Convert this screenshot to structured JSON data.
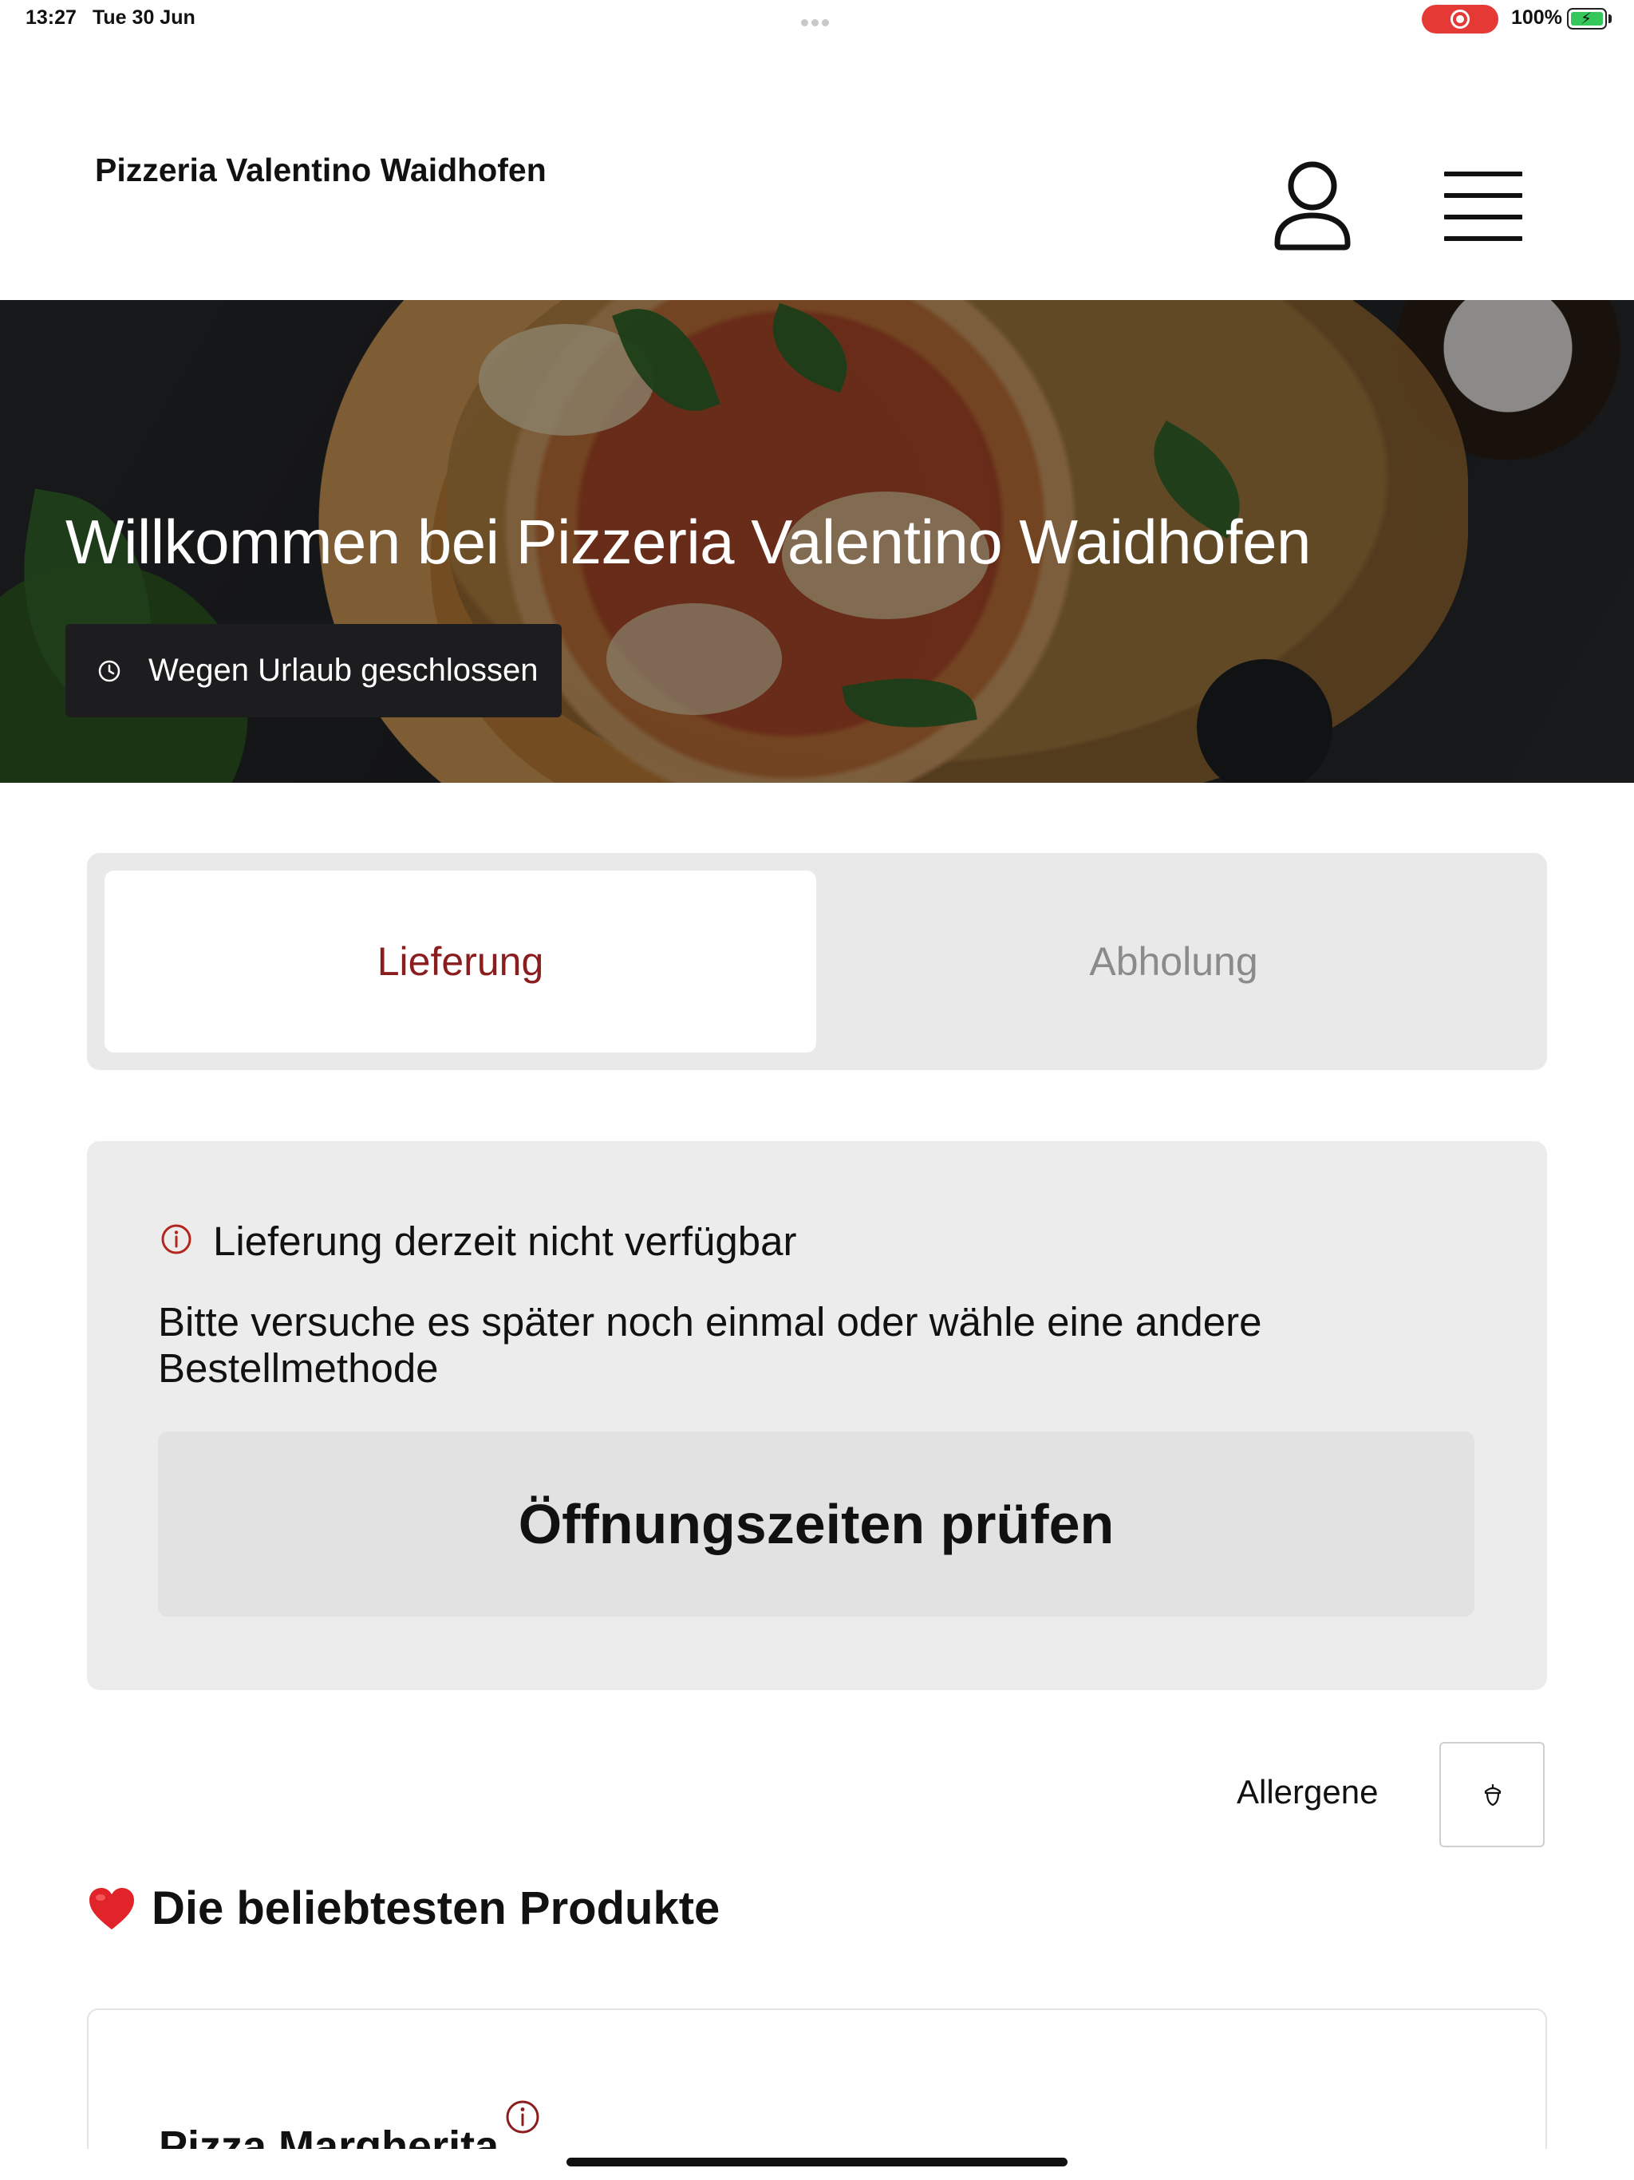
{
  "status_bar": {
    "time": "13:27",
    "date": "Tue 30 Jun",
    "battery_percent": "100%",
    "recording_color": "#e53935",
    "battery_color": "#35c759"
  },
  "header": {
    "brand": "Pizzeria Valentino Waidhofen",
    "account_icon": "user-icon",
    "menu_icon": "hamburger-menu-icon"
  },
  "hero": {
    "title": "Willkommen bei Pizzeria Valentino Waidhofen",
    "status_text": "Wegen Urlaub geschlossen",
    "status_icon": "clock-icon"
  },
  "order_method": {
    "tabs": [
      {
        "label": "Lieferung",
        "selected": true
      },
      {
        "label": "Abholung",
        "selected": false
      }
    ],
    "active_color": "#8a1d1d",
    "inactive_color": "#8b8b8b"
  },
  "notice": {
    "icon": "info-icon",
    "title": "Lieferung derzeit nicht verfügbar",
    "message": "Bitte versuche es später noch einmal oder wähle eine andere Bestellmethode",
    "button_label": "Öffnungszeiten prüfen"
  },
  "allergens": {
    "label": "Allergene",
    "icon": "acorn-icon"
  },
  "popular": {
    "icon": "heart-icon",
    "heading": "Die beliebtesten Produkte",
    "products": [
      {
        "name": "Pizza Margherita",
        "info_icon": "info-icon"
      }
    ]
  }
}
